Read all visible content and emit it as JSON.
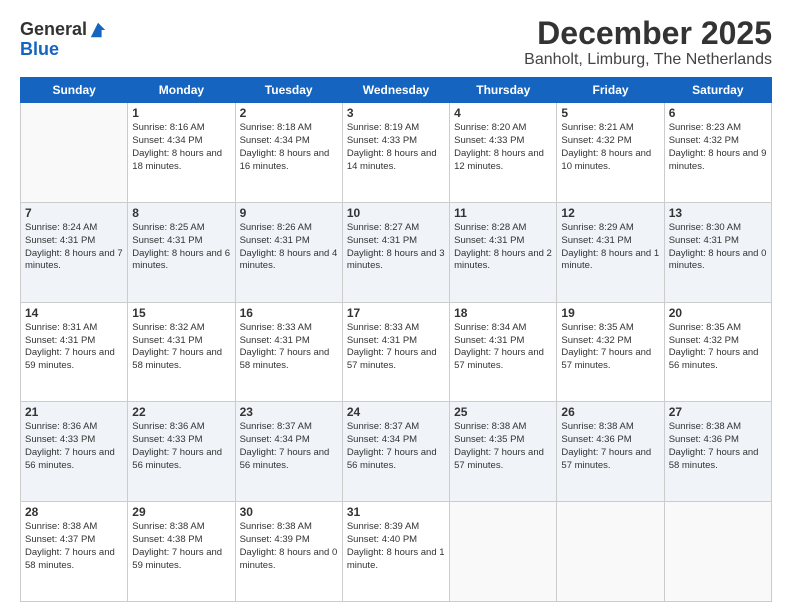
{
  "logo": {
    "general": "General",
    "blue": "Blue"
  },
  "title": "December 2025",
  "subtitle": "Banholt, Limburg, The Netherlands",
  "days": [
    "Sunday",
    "Monday",
    "Tuesday",
    "Wednesday",
    "Thursday",
    "Friday",
    "Saturday"
  ],
  "weeks": [
    [
      {
        "date": "",
        "sunrise": "",
        "sunset": "",
        "daylight": ""
      },
      {
        "date": "1",
        "sunrise": "Sunrise: 8:16 AM",
        "sunset": "Sunset: 4:34 PM",
        "daylight": "Daylight: 8 hours and 18 minutes."
      },
      {
        "date": "2",
        "sunrise": "Sunrise: 8:18 AM",
        "sunset": "Sunset: 4:34 PM",
        "daylight": "Daylight: 8 hours and 16 minutes."
      },
      {
        "date": "3",
        "sunrise": "Sunrise: 8:19 AM",
        "sunset": "Sunset: 4:33 PM",
        "daylight": "Daylight: 8 hours and 14 minutes."
      },
      {
        "date": "4",
        "sunrise": "Sunrise: 8:20 AM",
        "sunset": "Sunset: 4:33 PM",
        "daylight": "Daylight: 8 hours and 12 minutes."
      },
      {
        "date": "5",
        "sunrise": "Sunrise: 8:21 AM",
        "sunset": "Sunset: 4:32 PM",
        "daylight": "Daylight: 8 hours and 10 minutes."
      },
      {
        "date": "6",
        "sunrise": "Sunrise: 8:23 AM",
        "sunset": "Sunset: 4:32 PM",
        "daylight": "Daylight: 8 hours and 9 minutes."
      }
    ],
    [
      {
        "date": "7",
        "sunrise": "Sunrise: 8:24 AM",
        "sunset": "Sunset: 4:31 PM",
        "daylight": "Daylight: 8 hours and 7 minutes."
      },
      {
        "date": "8",
        "sunrise": "Sunrise: 8:25 AM",
        "sunset": "Sunset: 4:31 PM",
        "daylight": "Daylight: 8 hours and 6 minutes."
      },
      {
        "date": "9",
        "sunrise": "Sunrise: 8:26 AM",
        "sunset": "Sunset: 4:31 PM",
        "daylight": "Daylight: 8 hours and 4 minutes."
      },
      {
        "date": "10",
        "sunrise": "Sunrise: 8:27 AM",
        "sunset": "Sunset: 4:31 PM",
        "daylight": "Daylight: 8 hours and 3 minutes."
      },
      {
        "date": "11",
        "sunrise": "Sunrise: 8:28 AM",
        "sunset": "Sunset: 4:31 PM",
        "daylight": "Daylight: 8 hours and 2 minutes."
      },
      {
        "date": "12",
        "sunrise": "Sunrise: 8:29 AM",
        "sunset": "Sunset: 4:31 PM",
        "daylight": "Daylight: 8 hours and 1 minute."
      },
      {
        "date": "13",
        "sunrise": "Sunrise: 8:30 AM",
        "sunset": "Sunset: 4:31 PM",
        "daylight": "Daylight: 8 hours and 0 minutes."
      }
    ],
    [
      {
        "date": "14",
        "sunrise": "Sunrise: 8:31 AM",
        "sunset": "Sunset: 4:31 PM",
        "daylight": "Daylight: 7 hours and 59 minutes."
      },
      {
        "date": "15",
        "sunrise": "Sunrise: 8:32 AM",
        "sunset": "Sunset: 4:31 PM",
        "daylight": "Daylight: 7 hours and 58 minutes."
      },
      {
        "date": "16",
        "sunrise": "Sunrise: 8:33 AM",
        "sunset": "Sunset: 4:31 PM",
        "daylight": "Daylight: 7 hours and 58 minutes."
      },
      {
        "date": "17",
        "sunrise": "Sunrise: 8:33 AM",
        "sunset": "Sunset: 4:31 PM",
        "daylight": "Daylight: 7 hours and 57 minutes."
      },
      {
        "date": "18",
        "sunrise": "Sunrise: 8:34 AM",
        "sunset": "Sunset: 4:31 PM",
        "daylight": "Daylight: 7 hours and 57 minutes."
      },
      {
        "date": "19",
        "sunrise": "Sunrise: 8:35 AM",
        "sunset": "Sunset: 4:32 PM",
        "daylight": "Daylight: 7 hours and 57 minutes."
      },
      {
        "date": "20",
        "sunrise": "Sunrise: 8:35 AM",
        "sunset": "Sunset: 4:32 PM",
        "daylight": "Daylight: 7 hours and 56 minutes."
      }
    ],
    [
      {
        "date": "21",
        "sunrise": "Sunrise: 8:36 AM",
        "sunset": "Sunset: 4:33 PM",
        "daylight": "Daylight: 7 hours and 56 minutes."
      },
      {
        "date": "22",
        "sunrise": "Sunrise: 8:36 AM",
        "sunset": "Sunset: 4:33 PM",
        "daylight": "Daylight: 7 hours and 56 minutes."
      },
      {
        "date": "23",
        "sunrise": "Sunrise: 8:37 AM",
        "sunset": "Sunset: 4:34 PM",
        "daylight": "Daylight: 7 hours and 56 minutes."
      },
      {
        "date": "24",
        "sunrise": "Sunrise: 8:37 AM",
        "sunset": "Sunset: 4:34 PM",
        "daylight": "Daylight: 7 hours and 56 minutes."
      },
      {
        "date": "25",
        "sunrise": "Sunrise: 8:38 AM",
        "sunset": "Sunset: 4:35 PM",
        "daylight": "Daylight: 7 hours and 57 minutes."
      },
      {
        "date": "26",
        "sunrise": "Sunrise: 8:38 AM",
        "sunset": "Sunset: 4:36 PM",
        "daylight": "Daylight: 7 hours and 57 minutes."
      },
      {
        "date": "27",
        "sunrise": "Sunrise: 8:38 AM",
        "sunset": "Sunset: 4:36 PM",
        "daylight": "Daylight: 7 hours and 58 minutes."
      }
    ],
    [
      {
        "date": "28",
        "sunrise": "Sunrise: 8:38 AM",
        "sunset": "Sunset: 4:37 PM",
        "daylight": "Daylight: 7 hours and 58 minutes."
      },
      {
        "date": "29",
        "sunrise": "Sunrise: 8:38 AM",
        "sunset": "Sunset: 4:38 PM",
        "daylight": "Daylight: 7 hours and 59 minutes."
      },
      {
        "date": "30",
        "sunrise": "Sunrise: 8:38 AM",
        "sunset": "Sunset: 4:39 PM",
        "daylight": "Daylight: 8 hours and 0 minutes."
      },
      {
        "date": "31",
        "sunrise": "Sunrise: 8:39 AM",
        "sunset": "Sunset: 4:40 PM",
        "daylight": "Daylight: 8 hours and 1 minute."
      },
      {
        "date": "",
        "sunrise": "",
        "sunset": "",
        "daylight": ""
      },
      {
        "date": "",
        "sunrise": "",
        "sunset": "",
        "daylight": ""
      },
      {
        "date": "",
        "sunrise": "",
        "sunset": "",
        "daylight": ""
      }
    ]
  ]
}
